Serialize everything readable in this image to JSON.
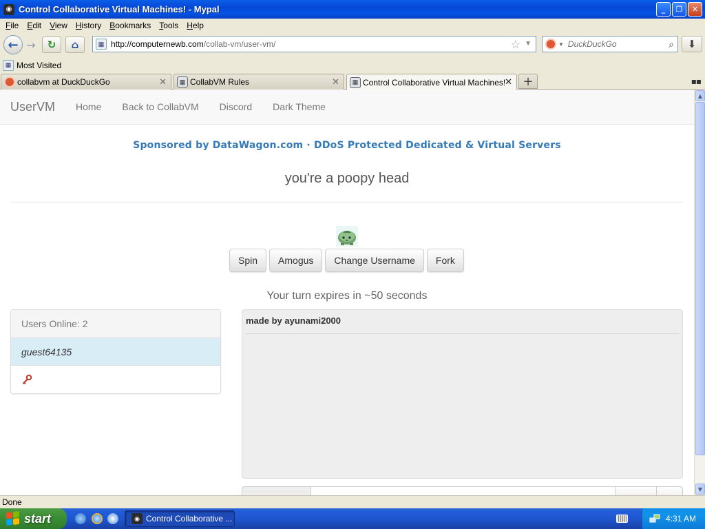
{
  "window": {
    "title": "Control Collaborative Virtual Machines! - Mypal",
    "minimize": "_",
    "maximize": "❐",
    "close": "✕"
  },
  "menu": [
    "File",
    "Edit",
    "View",
    "History",
    "Bookmarks",
    "Tools",
    "Help"
  ],
  "toolbar": {
    "url_host": "http://computernewb.com",
    "url_path": "/collab-vm/user-vm/",
    "search_placeholder": "DuckDuckGo"
  },
  "bookmarks": {
    "most_visited": "Most Visited"
  },
  "tabs": [
    {
      "label": "collabvm at DuckDuckGo",
      "active": false
    },
    {
      "label": "CollabVM Rules",
      "active": false
    },
    {
      "label": "Control Collaborative Virtual Machines!",
      "active": true
    }
  ],
  "page": {
    "brand": "UserVM",
    "nav": [
      "Home",
      "Back to CollabVM",
      "Discord",
      "Dark Theme"
    ],
    "sponsor": "Sponsored by DataWagon.com · DDoS Protected Dedicated & Virtual Servers",
    "motd": "you're a poopy head",
    "buttons": [
      "Spin",
      "Amogus",
      "Change Username",
      "Fork"
    ],
    "turn_text": "Your turn expires in ~50 seconds",
    "users_header": "Users Online: 2",
    "users": [
      "guest64135"
    ],
    "chat_messages": [
      {
        "text": "made by ayunami2000"
      }
    ]
  },
  "statusbar": {
    "text": "Done"
  },
  "taskbar": {
    "start": "start",
    "task_label": "Control Collaborative ...",
    "clock": "4:31 AM"
  },
  "colors": {
    "link": "#337ab7",
    "xp_blue": "#0553e6",
    "start_green": "#3c8f36",
    "user_highlight": "#d9edf7"
  }
}
